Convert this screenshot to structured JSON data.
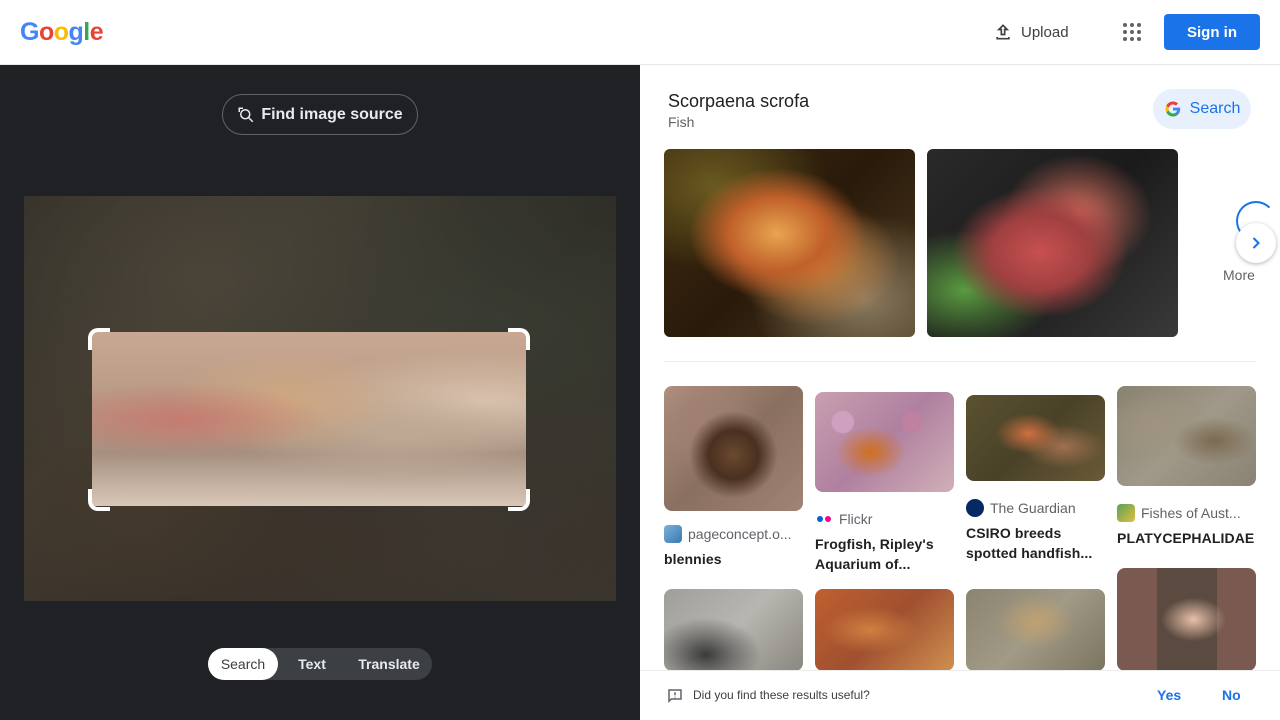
{
  "header": {
    "logo": [
      "G",
      "o",
      "o",
      "g",
      "l",
      "e"
    ],
    "logo_colors": [
      "#4285f4",
      "#ea4335",
      "#fbbc05",
      "#4285f4",
      "#34a853",
      "#ea4335"
    ],
    "upload_label": "Upload",
    "apps_icon": "apps-grid-icon",
    "signin_label": "Sign in"
  },
  "left_panel": {
    "find_source_label": "Find image source",
    "modes": [
      {
        "label": "Search",
        "active": true
      },
      {
        "label": "Text",
        "active": false
      },
      {
        "label": "Translate",
        "active": false
      }
    ]
  },
  "knowledge": {
    "title": "Scorpaena scrofa",
    "subtitle": "Fish",
    "search_label": "Search",
    "more_label": "More"
  },
  "results": [
    {
      "source": "pageconcept.o...",
      "title": "blennies"
    },
    {
      "source": "Flickr",
      "title": "Frogfish, Ripley's Aquarium of..."
    },
    {
      "source": "The Guardian",
      "title": "CSIRO breeds spotted handfish..."
    },
    {
      "source": "Fishes of Aust...",
      "title": "PLATYCEPHALIDAE"
    }
  ],
  "feedback": {
    "question": "Did you find these results useful?",
    "yes": "Yes",
    "no": "No"
  },
  "colors": {
    "accent": "#1a73e8",
    "left_bg": "#202124"
  }
}
